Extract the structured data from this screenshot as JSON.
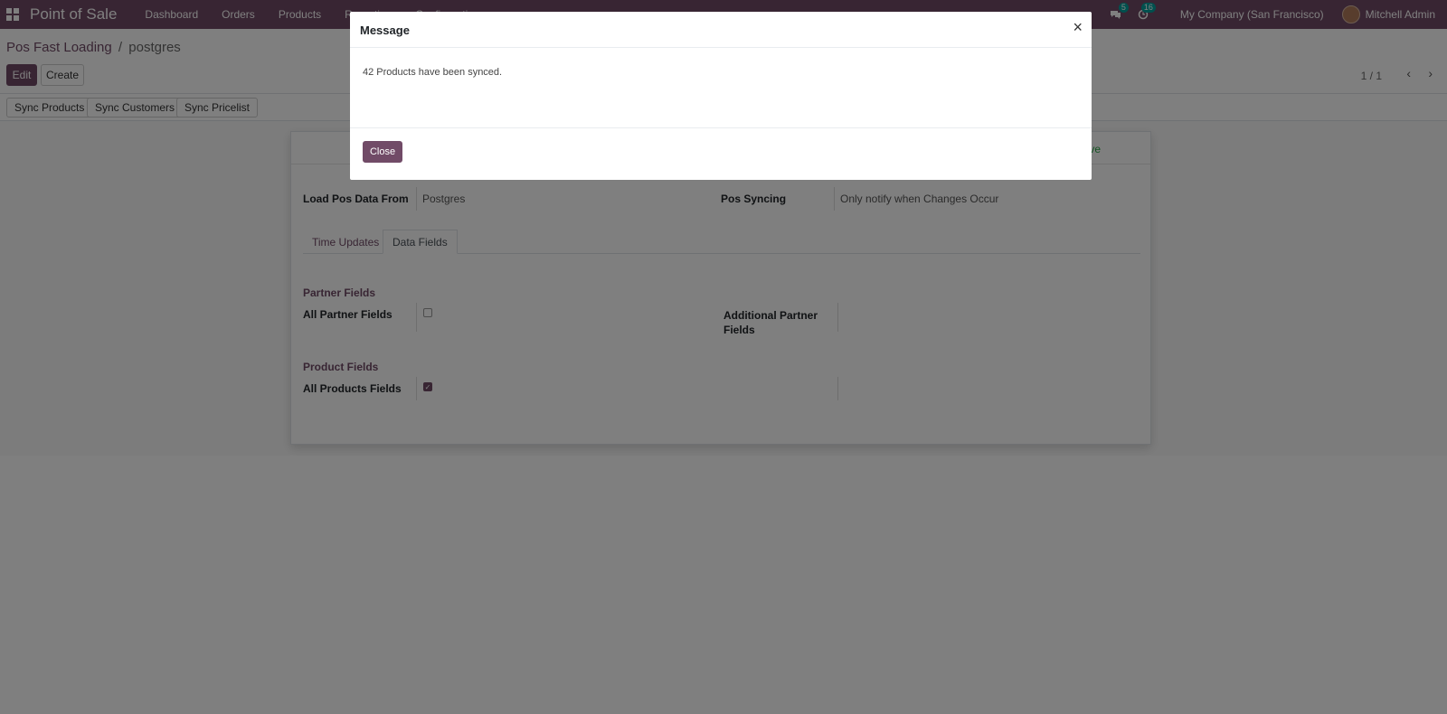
{
  "navbar": {
    "app_title": "Point of Sale",
    "menu": [
      "Dashboard",
      "Orders",
      "Products",
      "Reporting",
      "Configuration"
    ],
    "messages_badge": "5",
    "activities_badge": "16",
    "company": "My Company (San Francisco)",
    "user": "Mitchell Admin"
  },
  "breadcrumb": {
    "parent": "Pos Fast Loading",
    "separator": "/",
    "current": "postgres"
  },
  "control_panel": {
    "edit_label": "Edit",
    "create_label": "Create",
    "pager": "1 / 1",
    "prev_icon": "‹",
    "next_icon": "›"
  },
  "header_buttons": {
    "sync_products": "Sync Products",
    "sync_customers": "Sync Customers",
    "sync_pricelist": "Sync Pricelist"
  },
  "form": {
    "status_text": "tive",
    "load_pos_data_from_label": "Load Pos Data From",
    "load_pos_data_from_value": "Postgres",
    "pos_syncing_label": "Pos Syncing",
    "pos_syncing_value": "Only notify when Changes Occur",
    "tabs": [
      "Time Updates",
      "Data Fields"
    ],
    "partner_fields_title": "Partner Fields",
    "all_partner_fields_label": "All Partner Fields",
    "all_partner_fields_checked": false,
    "additional_partner_fields_label": "Additional Partner Fields",
    "product_fields_title": "Product Fields",
    "all_products_fields_label": "All Products Fields",
    "all_products_fields_checked": true
  },
  "modal": {
    "title": "Message",
    "close_icon": "×",
    "message": "42 Products have been synced.",
    "close_button": "Close"
  },
  "colors": {
    "brand": "#714b67",
    "active_green": "#28a745",
    "badge_teal": "#00a09d"
  }
}
